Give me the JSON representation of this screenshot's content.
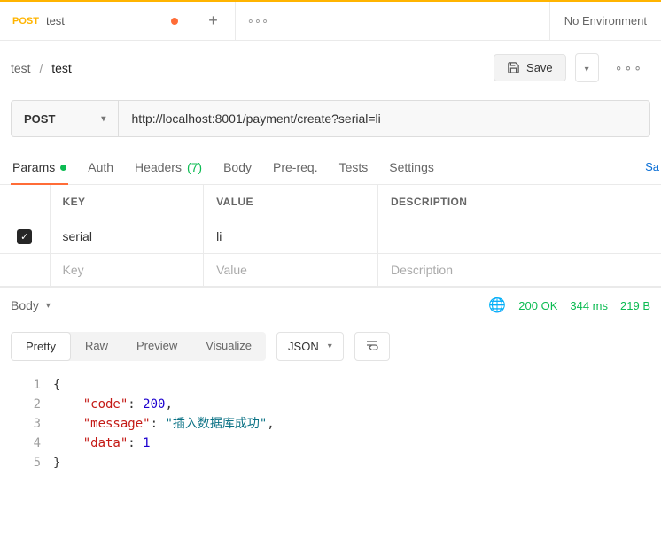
{
  "tab": {
    "method": "POST",
    "title": "test",
    "unsaved": true
  },
  "env": {
    "label": "No Environment"
  },
  "breadcrumb": {
    "parent": "test",
    "sep": "/",
    "current": "test"
  },
  "actions": {
    "save": "Save"
  },
  "request": {
    "method": "POST",
    "url": "http://localhost:8001/payment/create?serial=li"
  },
  "subtabs": {
    "params": "Params",
    "auth": "Auth",
    "headers": "Headers",
    "headers_count": "(7)",
    "body": "Body",
    "prereq": "Pre-req.",
    "tests": "Tests",
    "settings": "Settings"
  },
  "params_headers": {
    "key": "KEY",
    "value": "VALUE",
    "desc": "DESCRIPTION"
  },
  "params_rows": [
    {
      "checked": true,
      "key": "serial",
      "value": "li",
      "desc": ""
    }
  ],
  "params_placeholder": {
    "key": "Key",
    "value": "Value",
    "desc": "Description"
  },
  "response": {
    "section": "Body",
    "status": "200 OK",
    "time": "344 ms",
    "size": "219 B",
    "save_partial": "Sa"
  },
  "view": {
    "pretty": "Pretty",
    "raw": "Raw",
    "preview": "Preview",
    "visualize": "Visualize",
    "format": "JSON"
  },
  "code": {
    "lines": [
      "1",
      "2",
      "3",
      "4",
      "5"
    ],
    "k_code": "\"code\"",
    "v_code": "200",
    "k_msg": "\"message\"",
    "v_msg": "\"插入数据库成功\"",
    "k_data": "\"data\"",
    "v_data": "1"
  }
}
